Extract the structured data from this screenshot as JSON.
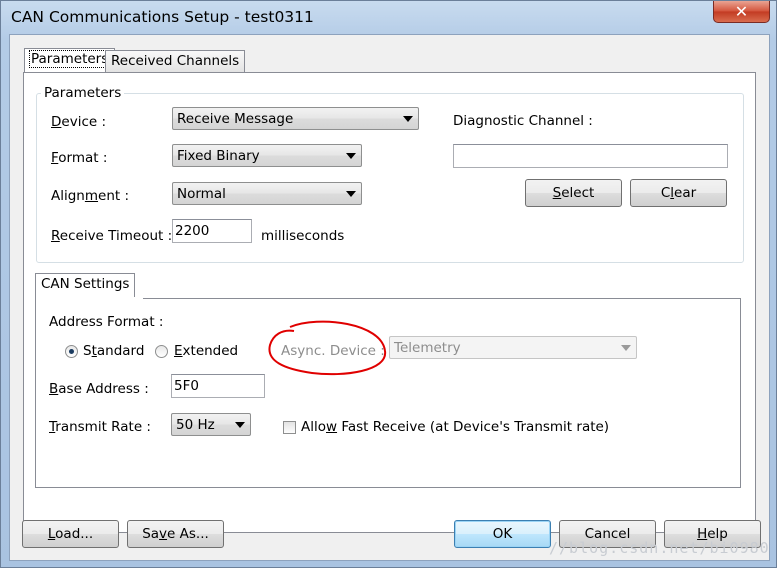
{
  "window": {
    "title": "CAN Communications Setup - test0311",
    "close_glyph": "✕"
  },
  "tabs": [
    {
      "label": "Parameters",
      "active": true
    },
    {
      "label": "Received Channels",
      "active": false
    }
  ],
  "parameters_group": {
    "label": "Parameters",
    "device_label": "Device :",
    "device_value": "Receive Message",
    "format_label": "Format :",
    "format_value": "Fixed Binary",
    "alignment_label": "Alignment :",
    "alignment_value": "Normal",
    "timeout_label": "Receive Timeout :",
    "timeout_value": "2200",
    "timeout_unit": "milliseconds",
    "diag_label": "Diagnostic Channel :",
    "diag_value": "",
    "select_button": "Select",
    "clear_button": "Clear"
  },
  "can_settings": {
    "tab_label": "CAN Settings",
    "address_format_label": "Address Format :",
    "radio_standard": "Standard",
    "radio_extended": "Extended",
    "selected_format": "Standard",
    "async_label": "Async. Device :",
    "async_value": "Telemetry",
    "base_address_label": "Base Address :",
    "base_address_value": "5F0",
    "transmit_rate_label": "Transmit Rate :",
    "transmit_rate_value": "50 Hz",
    "fast_receive_label": "Allow Fast Receive (at Device's Transmit rate)",
    "fast_receive_checked": false
  },
  "footer": {
    "load_button": "Load...",
    "save_as_button": "Save As...",
    "ok_button": "OK",
    "cancel_button": "Cancel",
    "help_button": "Help"
  },
  "annotation": {
    "color": "#e00000"
  },
  "watermark": "//blog.csdn.net/bi0980"
}
